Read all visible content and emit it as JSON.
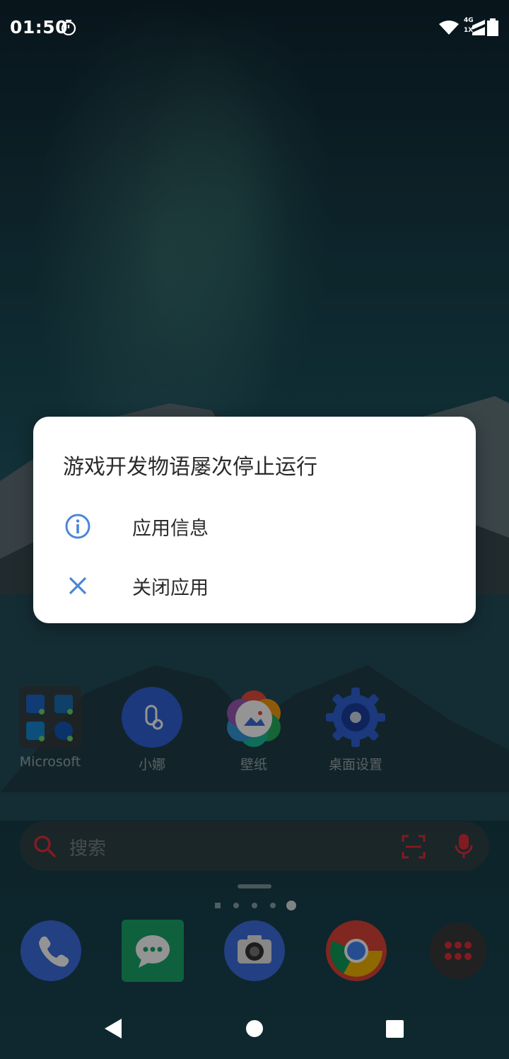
{
  "status_bar": {
    "time": "01:50",
    "network_top": "4G",
    "network_bottom": "1X"
  },
  "dialog": {
    "title": "游戏开发物语屡次停止运行",
    "items": [
      {
        "label": "应用信息",
        "icon": "info-icon"
      },
      {
        "label": "关闭应用",
        "icon": "close-icon"
      }
    ],
    "accent": "#4a86d8"
  },
  "home": {
    "apps": [
      {
        "label": "Microsoft",
        "icon": "microsoft-folder-icon"
      },
      {
        "label": "小娜",
        "icon": "cortana-icon"
      },
      {
        "label": "壁纸",
        "icon": "wallpaper-icon"
      },
      {
        "label": "桌面设置",
        "icon": "gear-icon"
      }
    ],
    "search": {
      "placeholder": "搜索"
    },
    "dock": [
      "phone-icon",
      "messages-icon",
      "camera-icon",
      "chrome-icon",
      "app-drawer-icon"
    ]
  }
}
